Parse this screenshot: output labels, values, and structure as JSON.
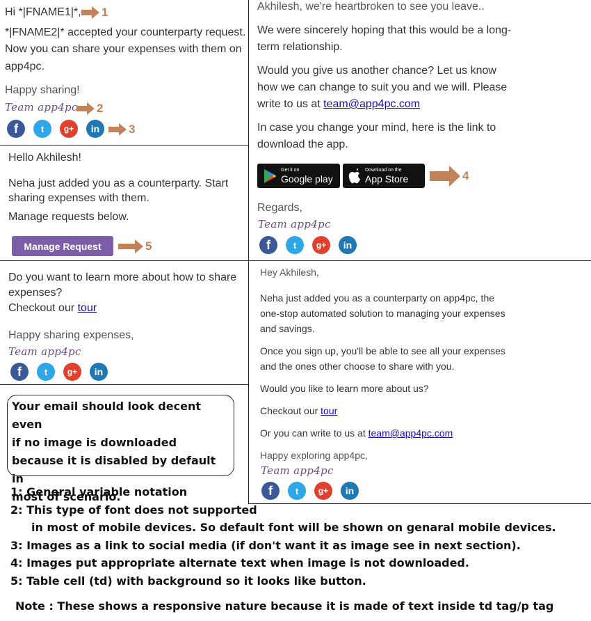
{
  "panel_tl": {
    "greeting": "Hi *|FNAME1|*,",
    "line1": "*|FNAME2|* accepted your counterparty request.",
    "line2": "Now you can share your expenses with them on",
    "line3": "app4pc.",
    "signoff": "Happy sharing!",
    "team": "Team app4pc"
  },
  "panel_ml": {
    "greeting": "Hello Akhilesh!",
    "body1": "Neha just added you as a counterparty. Start",
    "body2": "sharing expenses with them.",
    "body3": "Manage requests below.",
    "button_label": "Manage Request"
  },
  "panel_bl": {
    "q1": "Do you want to learn more about how to share",
    "q2": "expenses?",
    "checkout_prefix": "Checkout our ",
    "tour_link": "tour",
    "signoff": "Happy sharing expenses,",
    "team": "Team app4pc"
  },
  "panel_tr": {
    "head": "Akhilesh, we're heartbroken to see you leave..",
    "p1a": "We were sincerely hoping that this would be a long-",
    "p1b": "term relationship.",
    "p2a": "Would you give us another chance? Let us know",
    "p2b": "how we can change to suit you and we will. Please",
    "p2c_prefix": "write to us at ",
    "email": "team@app4pc.com",
    "p3a": "In case you change your mind, here is the link to",
    "p3b": "download the app.",
    "google_small": "Get it on",
    "google_big": "Google play",
    "apple_small": "Download on the",
    "apple_big": "App Store",
    "regards": "Regards,",
    "team": "Team app4pc"
  },
  "panel_br": {
    "greeting": "Hey Akhilesh,",
    "p1a": "Neha just added you as a counterparty on app4pc, the",
    "p1b": "one-stop automated solution to managing your expenses",
    "p1c": "and savings.",
    "p2a": "Once you sign up, you'll be able to see all your expenses",
    "p2b": "and the ones other choose to share with you.",
    "p3": "Would you like to learn more about us?",
    "checkout_prefix": "Checkout our ",
    "tour_link": "tour",
    "write_prefix": "Or you can write to us at ",
    "email": "team@app4pc.com",
    "signoff": "Happy exploring app4pc,",
    "team": "Team app4pc"
  },
  "social": {
    "facebook": "f",
    "twitter": "t",
    "googleplus": "g+",
    "linkedin": "in"
  },
  "markers": {
    "m1": "1",
    "m2": "2",
    "m3": "3",
    "m4": "4",
    "m5": "5"
  },
  "notebox": {
    "l1": "Your email should look decent even",
    "l2": "if no image is downloaded",
    "l3": "because it is disabled by default in",
    "l4": "most of scenario."
  },
  "notes": {
    "n1": "1: General variable notation",
    "n2a": "2: This type of font does not supported",
    "n2b": "in most of mobile devices. So default font will be shown on genaral mobile devices.",
    "n3": "3: Images as a link to social media (if don't want it as image see in next section).",
    "n4": "4: Images put appropriate alternate text when image is not downloaded.",
    "n5": "5: Table cell (td) with background so it looks like button.",
    "footer": "Note : These shows a responsive nature because it is made of text inside td tag/p tag"
  },
  "colors": {
    "arrow": "#c2835a",
    "button": "#7b5ea7",
    "link": "#1a0dab"
  }
}
